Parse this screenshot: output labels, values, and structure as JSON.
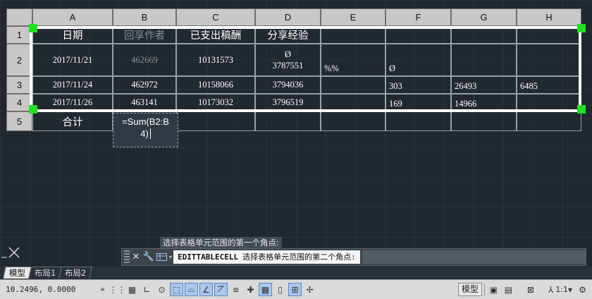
{
  "table": {
    "column_headers": [
      "A",
      "B",
      "C",
      "D",
      "E",
      "F",
      "G",
      "H"
    ],
    "row_headers": [
      "1",
      "2",
      "3",
      "4",
      "5"
    ],
    "rows": [
      [
        "日期",
        "回享作者",
        "已支出稿酬",
        "分享经验",
        "",
        "",
        "",
        ""
      ],
      [
        "2017/11/21",
        "462669",
        "10131573",
        "Ø\n3787551",
        "%%",
        "Ø",
        "",
        ""
      ],
      [
        "2017/11/24",
        "462972",
        "10158066",
        "3794036",
        "",
        "303",
        "26493",
        "6485"
      ],
      [
        "2017/11/26",
        "463141",
        "10173032",
        "3796519",
        "",
        "169",
        "14966",
        ""
      ],
      [
        "合计",
        "",
        "",
        "",
        "",
        "",
        "",
        ""
      ]
    ],
    "editor_text": "=Sum(B2:B4)",
    "editor_line1": "=Sum(B2:B",
    "editor_line2": "4)"
  },
  "command": {
    "previous_prompt": "选择表格单元范围的第一个角点:",
    "command_name": "EDITTABLECELL",
    "prompt": "选择表格单元范围的第二个角点:"
  },
  "layout_tabs": [
    "模型",
    "布局1",
    "布局2"
  ],
  "status": {
    "coordinates": "10.2496, 0.0000",
    "model_label": "模型",
    "scale": "1:1"
  },
  "colors": {
    "grip": "#22e022",
    "background": "#212830",
    "selection": "#ffffff"
  }
}
